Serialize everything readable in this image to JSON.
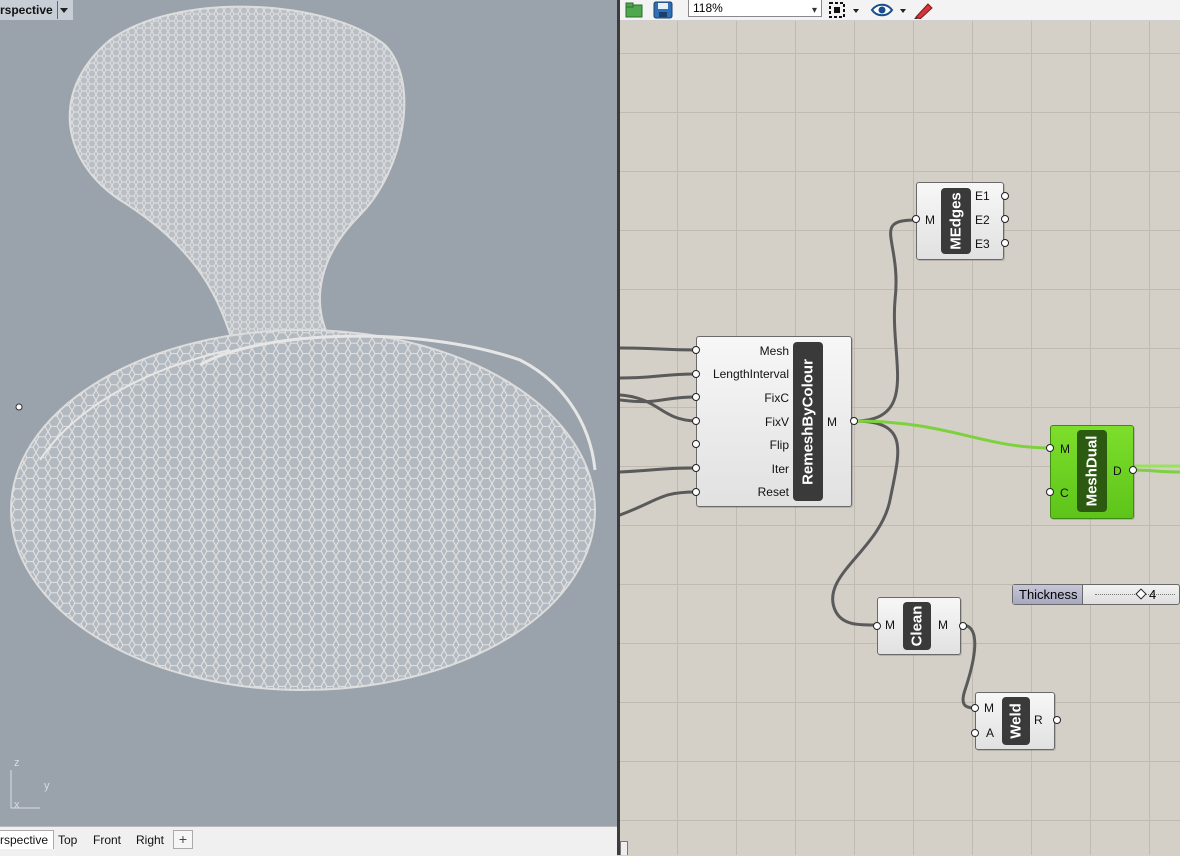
{
  "viewport": {
    "title": "rspective",
    "axes": {
      "z": "z",
      "y": "y",
      "x": "x"
    },
    "tabs": [
      "rspective",
      "Top",
      "Front",
      "Right"
    ],
    "add_tab": "+",
    "colors": {
      "background": "#9aa2ab",
      "mesh": "#d9d9d9"
    }
  },
  "gh": {
    "toolbar": {
      "zoom": "118%",
      "icons": [
        "open-file-icon",
        "save-icon",
        "zoom-dropdown",
        "selection-icon",
        "preview-eye-icon",
        "sketch-pen-icon"
      ]
    },
    "components": {
      "remesh": {
        "name": "RemeshByColour",
        "inputs": [
          "Mesh",
          "LengthInterval",
          "FixC",
          "FixV",
          "Flip",
          "Iter",
          "Reset"
        ],
        "output": "M"
      },
      "medges": {
        "name": "MEdges",
        "input": "M",
        "outputs": [
          "E1",
          "E2",
          "E3"
        ]
      },
      "meshdual": {
        "name": "MeshDual",
        "inputs": [
          "M",
          "C"
        ],
        "output": "D"
      },
      "clean": {
        "name": "Clean",
        "input": "M",
        "output": "M"
      },
      "weld": {
        "name": "Weld",
        "inputs": [
          "M",
          "A"
        ],
        "output": "R"
      }
    },
    "slider": {
      "label": "Thickness",
      "value": "4"
    },
    "colors": {
      "canvas": "#d4d0c8",
      "wire": "#5a5a5a",
      "active_wire": "#7ed13e",
      "selected_component": "#6fd524"
    }
  }
}
